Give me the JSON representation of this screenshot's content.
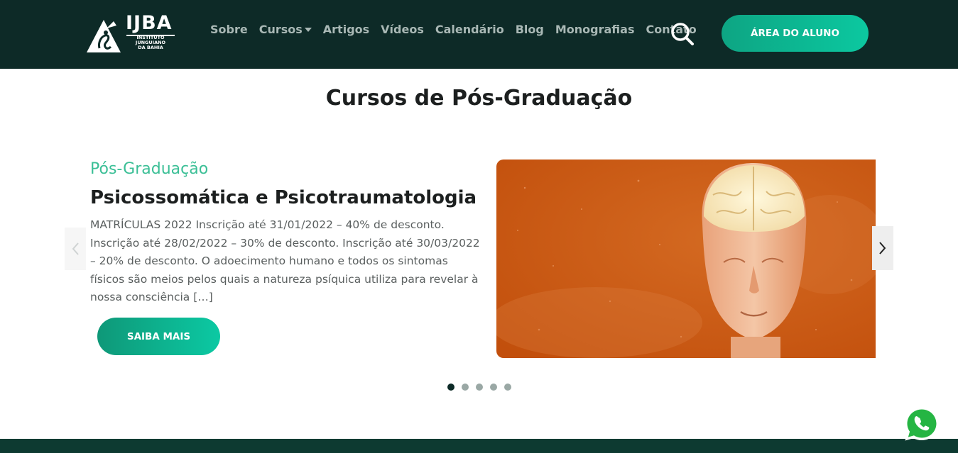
{
  "brand": {
    "logo_text": "IJBA",
    "logo_subtitle": [
      "INSTITUTO",
      "JUNGUIANO",
      "DA BAHIA"
    ]
  },
  "nav": {
    "items": [
      {
        "label": "Sobre"
      },
      {
        "label": "Cursos",
        "has_dropdown": true
      },
      {
        "label": "Artigos"
      },
      {
        "label": "Vídeos"
      },
      {
        "label": "Calendário"
      },
      {
        "label": "Blog"
      },
      {
        "label": "Monografias"
      },
      {
        "label": "Contato"
      }
    ],
    "search_icon": "search-icon",
    "student_area_label": "ÁREA DO ALUNO"
  },
  "main": {
    "title": "Cursos de Pós-Graduação",
    "slide": {
      "category": "Pós-Graduação",
      "title": "Psicossomática e Psicotraumatologia",
      "description": "MATRÍCULAS 2022 Inscrição até 31/01/2022 – 40% de desconto. Inscrição até 28/02/2022 – 30% de desconto. Inscrição até 30/03/2022 – 20% de desconto.   O adoecimento humano e todos os sintomas físicos são meios pelos quais a natureza psíquica utiliza para revelar à nossa consciência […]",
      "button_label": "SAIBA MAIS"
    },
    "carousel": {
      "total_slides": 5,
      "active_index": 0
    }
  },
  "colors": {
    "header_bg": "#0d2a27",
    "accent": "#0cc8a0",
    "category_text": "#3bbf96",
    "image_orange": "#c9570f"
  }
}
